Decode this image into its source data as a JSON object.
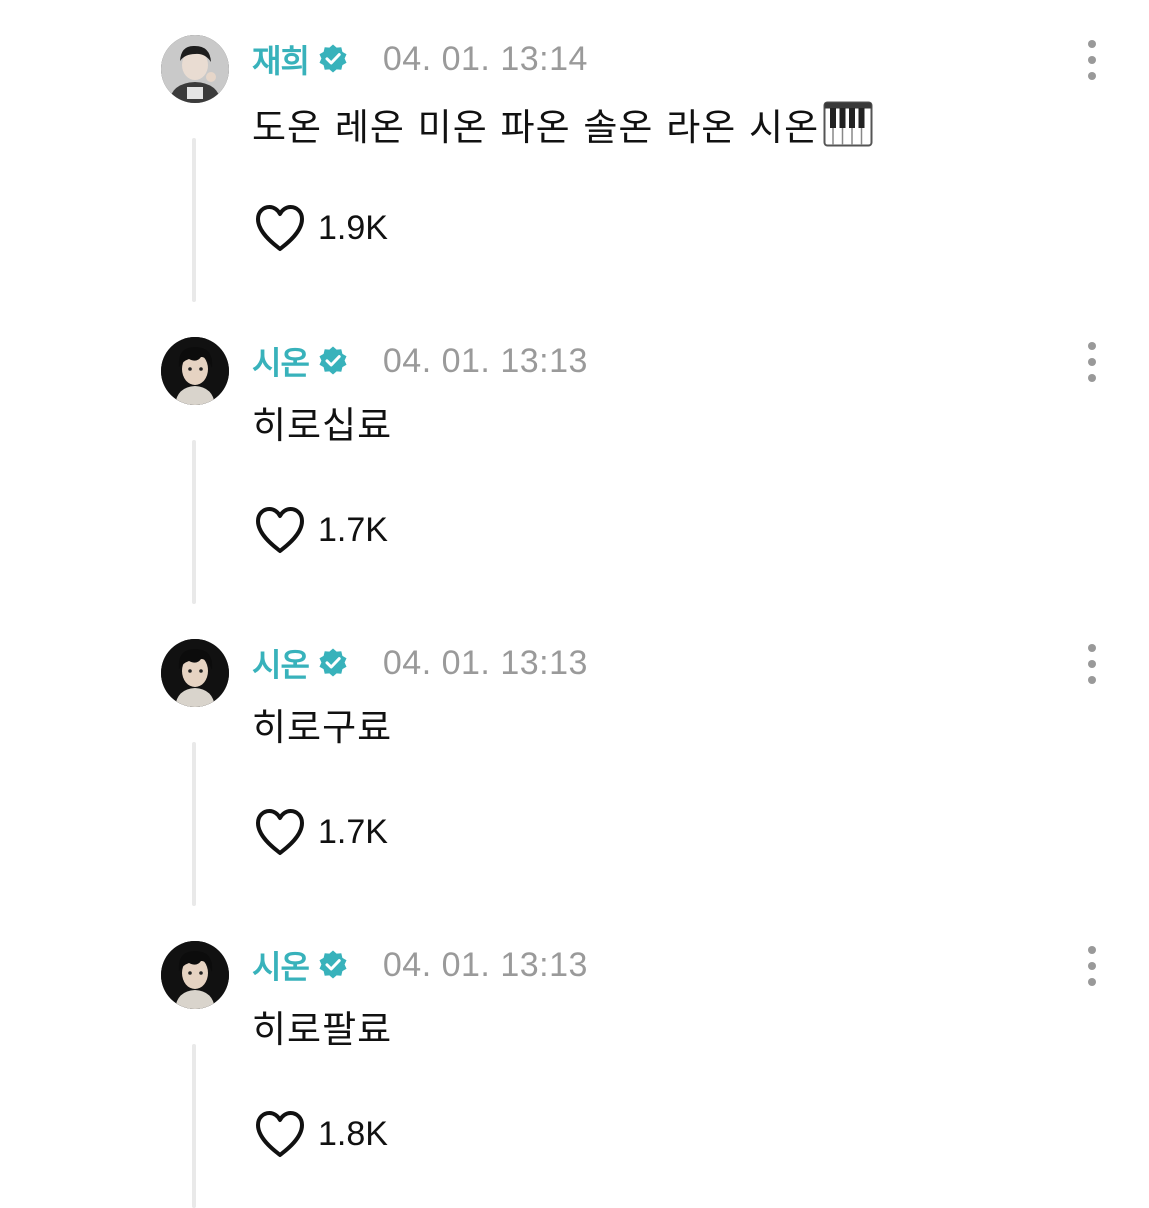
{
  "colors": {
    "username": "#38b2bb",
    "timestamp": "#9a9a9a",
    "thread_line": "#e9e9e9"
  },
  "posts": [
    {
      "username": "재희",
      "timestamp": "04. 01. 13:14",
      "content": "도온 레온 미온 파온 솔온 라온 시온",
      "emoji": "piano-icon",
      "likes": "1.9K"
    },
    {
      "username": "시온",
      "timestamp": "04. 01. 13:13",
      "content": "히로십료",
      "likes": "1.7K"
    },
    {
      "username": "시온",
      "timestamp": "04. 01. 13:13",
      "content": "히로구료",
      "likes": "1.7K"
    },
    {
      "username": "시온",
      "timestamp": "04. 01. 13:13",
      "content": "히로팔료",
      "likes": "1.8K"
    }
  ]
}
